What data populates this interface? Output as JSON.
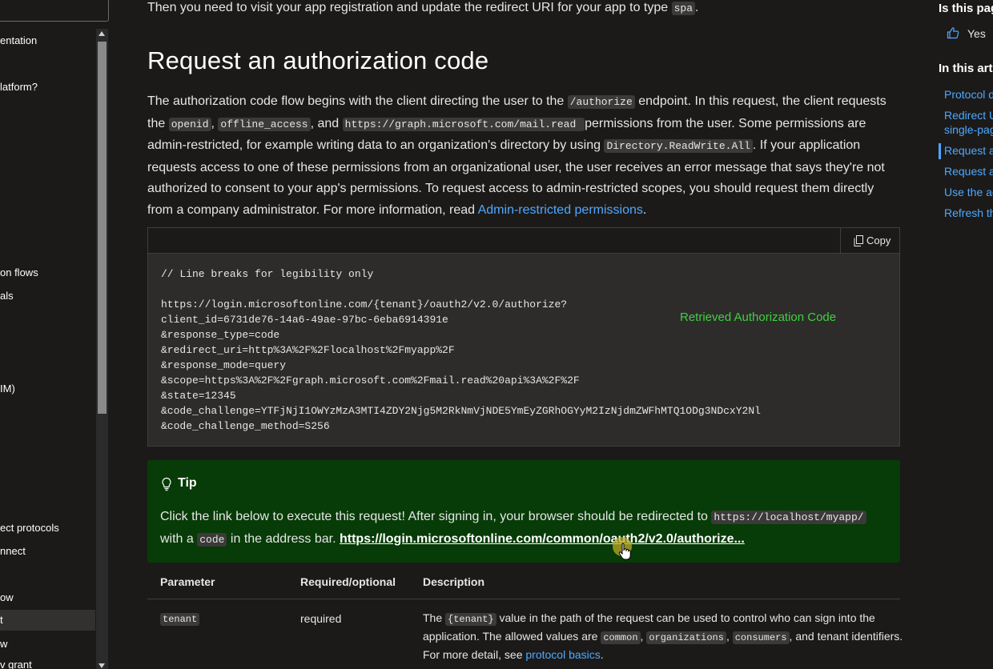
{
  "sidebar": {
    "items": [
      {
        "label": "entation"
      },
      {
        "label": "latform?"
      },
      {
        "label": "on flows"
      },
      {
        "label": "als"
      },
      {
        "label": "IM)"
      },
      {
        "label": "ect protocols"
      },
      {
        "label": "nnect"
      },
      {
        "label": "ow"
      },
      {
        "label": "t"
      },
      {
        "label": "w"
      },
      {
        "label": "v grant"
      }
    ]
  },
  "main": {
    "intro_before": "Then you need to visit your app registration and update the redirect URI for your app to type ",
    "intro_code": "spa",
    "intro_after": ".",
    "title": "Request an authorization code",
    "para": {
      "t1": "The authorization code flow begins with the client directing the user to the ",
      "c1": "/authorize",
      "t2": " endpoint. In this request, the client requests the ",
      "c2": "openid",
      "t3": ", ",
      "c3": "offline_access",
      "t4": ", and ",
      "c4": "https://graph.microsoft.com/mail.read ",
      "t5": " permissions from the user. Some permissions are admin-restricted, for example writing data to an organization's directory by using ",
      "c5": "Directory.ReadWrite.All",
      "t6": ". If your application requests access to one of these permissions from an organizational user, the user receives an error message that says they're not authorized to consent to your app's permissions. To request access to admin-restricted scopes, you should request them directly from a company administrator. For more information, read ",
      "link": "Admin-restricted permissions",
      "t7": "."
    },
    "code_block": {
      "copy_label": "Copy",
      "code": "// Line breaks for legibility only\n\nhttps://login.microsoftonline.com/{tenant}/oauth2/v2.0/authorize?\nclient_id=6731de76-14a6-49ae-97bc-6eba6914391e\n&response_type=code\n&redirect_uri=http%3A%2F%2Flocalhost%2Fmyapp%2F\n&response_mode=query\n&scope=https%3A%2F%2Fgraph.microsoft.com%2Fmail.read%20api%3A%2F%2F\n&state=12345\n&code_challenge=YTFjNjI1OWYzMzA3MTI4ZDY2Njg5M2RkNmVjNDE5YmEyZGRhOGYyM2IzNjdmZWFhMTQ1ODg3NDcxY2Nl\n&code_challenge_method=S256",
      "overlay_text": "Retrieved Authorization Code",
      "overlay_color": "#3fd13f"
    },
    "tip": {
      "title": "Tip",
      "t1": "Click the link below to execute this request! After signing in, your browser should be redirected to ",
      "c1": "https://localhost/myapp/",
      "t2": " with a ",
      "c2": "code",
      "t3": " in the address bar. ",
      "link": "https://login.microsoftonline.com/common/oauth2/v2.0/authorize..."
    },
    "table": {
      "headers": [
        "Parameter",
        "Required/optional",
        "Description"
      ],
      "row": {
        "param": "tenant",
        "required": "required",
        "d1": "The ",
        "dc1": "{tenant}",
        "d2": " value in the path of the request can be used to control who can sign into the application. The allowed values are ",
        "dc2": "common",
        "d3": ", ",
        "dc3": "organizations",
        "d4": ", ",
        "dc4": "consumers",
        "d5": ", and tenant identifiers. For more detail, see ",
        "dlink": "protocol basics",
        "d6": "."
      }
    }
  },
  "rail": {
    "question": "Is this pag",
    "yes": "Yes",
    "in_this_article": "In this art",
    "toc": [
      "Protocol d",
      "Redirect U",
      "single-pag",
      "Request a",
      "Request a",
      "Use the ac",
      "Refresh th"
    ]
  },
  "colors": {
    "link": "#4fa8ff",
    "tip_bg": "#073b07",
    "accent_green": "#3fd13f"
  }
}
